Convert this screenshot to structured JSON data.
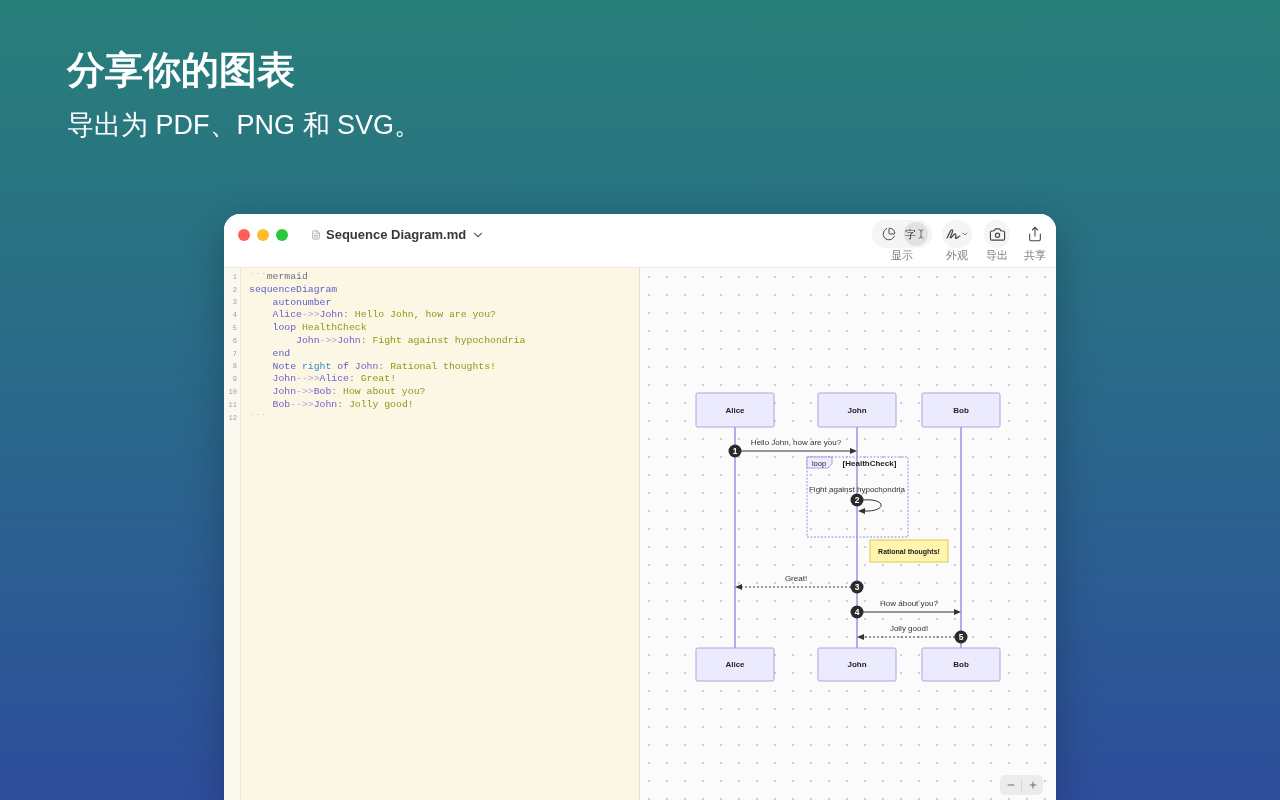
{
  "hero": {
    "title": "分享你的图表",
    "subtitle": "导出为 PDF、PNG 和 SVG。"
  },
  "window": {
    "title": "Sequence Diagram.md",
    "toolbar": {
      "display": {
        "label": "显示",
        "options": [
          {
            "kind": "icon",
            "selected": false
          },
          {
            "kind": "glyph",
            "glyph": "字",
            "selected": true
          }
        ]
      },
      "actions": [
        {
          "kind": "menu",
          "label": "外观"
        },
        {
          "kind": "plain",
          "label": "导出"
        },
        {
          "kind": "plain",
          "label": "共享"
        }
      ]
    }
  },
  "editor": {
    "lines": [
      {
        "number": "1",
        "tokens": [
          {
            "kind": "fence",
            "text": "```"
          },
          {
            "kind": "lang",
            "text": "mermaid"
          }
        ]
      },
      {
        "number": "2",
        "tokens": [
          {
            "kind": "keyword",
            "text": "sequenceDiagram"
          }
        ],
        "children": [
          {
            "number": "3",
            "tokens": [
              {
                "kind": "keyword",
                "text": "autonumber"
              }
            ]
          },
          {
            "number": "4",
            "tokens": [
              {
                "kind": "actor",
                "text": "Alice"
              },
              {
                "kind": "arrow",
                "text": "->>"
              },
              {
                "kind": "actor",
                "text": "John"
              },
              {
                "kind": "punct",
                "text": ": "
              },
              {
                "kind": "text",
                "text": "Hello John, how are you?"
              }
            ]
          },
          {
            "number": "5",
            "tokens": [
              {
                "kind": "keyword",
                "text": "loop"
              },
              {
                "kind": "text",
                "text": " HealthCheck"
              }
            ],
            "children": [
              {
                "number": "6",
                "tokens": [
                  {
                    "kind": "actor",
                    "text": "John"
                  },
                  {
                    "kind": "arrow",
                    "text": "->>"
                  },
                  {
                    "kind": "actor",
                    "text": "John"
                  },
                  {
                    "kind": "punct",
                    "text": ": "
                  },
                  {
                    "kind": "text",
                    "text": "Fight against hypochondria"
                  }
                ]
              }
            ]
          },
          {
            "number": "7",
            "tokens": [
              {
                "kind": "keyword",
                "text": "end"
              }
            ]
          },
          {
            "number": "8",
            "tokens": [
              {
                "kind": "keyword",
                "text": "Note"
              },
              {
                "kind": "direction",
                "text": " right"
              },
              {
                "kind": "keyword",
                "text": " of"
              },
              {
                "kind": "actor",
                "text": " John"
              },
              {
                "kind": "punct",
                "text": ": "
              },
              {
                "kind": "text",
                "text": "Rational thoughts!"
              }
            ]
          },
          {
            "number": "9",
            "tokens": [
              {
                "kind": "actor",
                "text": "John"
              },
              {
                "kind": "arrow",
                "text": "-->>"
              },
              {
                "kind": "actor",
                "text": "Alice"
              },
              {
                "kind": "punct",
                "text": ": "
              },
              {
                "kind": "text",
                "text": "Great!"
              }
            ]
          },
          {
            "number": "10",
            "tokens": [
              {
                "kind": "actor",
                "text": "John"
              },
              {
                "kind": "arrow",
                "text": "->>"
              },
              {
                "kind": "actor",
                "text": "Bob"
              },
              {
                "kind": "punct",
                "text": ": "
              },
              {
                "kind": "text",
                "text": "How about you?"
              }
            ]
          },
          {
            "number": "11",
            "tokens": [
              {
                "kind": "actor",
                "text": "Bob"
              },
              {
                "kind": "arrow",
                "text": "-->>"
              },
              {
                "kind": "actor",
                "text": "John"
              },
              {
                "kind": "punct",
                "text": ": "
              },
              {
                "kind": "text",
                "text": "Jolly good!"
              }
            ]
          }
        ]
      },
      {
        "number": "12",
        "tokens": [
          {
            "kind": "fence",
            "text": "```"
          }
        ]
      }
    ]
  },
  "diagram": {
    "participants": [
      {
        "top": "Alice",
        "bottom": "Alice"
      },
      {
        "top": "John",
        "bottom": "John"
      },
      {
        "top": "Bob",
        "bottom": "Bob"
      }
    ],
    "sequence": [
      {
        "kind": "message",
        "number": "1",
        "label": "Hello John, how are you?",
        "dashed": false
      },
      {
        "kind": "loop",
        "tag": "loop",
        "condition": "[HealthCheck]",
        "children": [
          {
            "kind": "self",
            "number": "2",
            "label": "Fight against hypochondria",
            "dashed": false
          }
        ]
      },
      {
        "kind": "note",
        "text": "Rational thoughts!"
      },
      {
        "kind": "message",
        "number": "3",
        "label": "Great!",
        "dashed": true
      },
      {
        "kind": "message",
        "number": "4",
        "label": "How about you?",
        "dashed": false
      },
      {
        "kind": "message",
        "number": "5",
        "label": "Jolly good!",
        "dashed": true
      }
    ]
  }
}
